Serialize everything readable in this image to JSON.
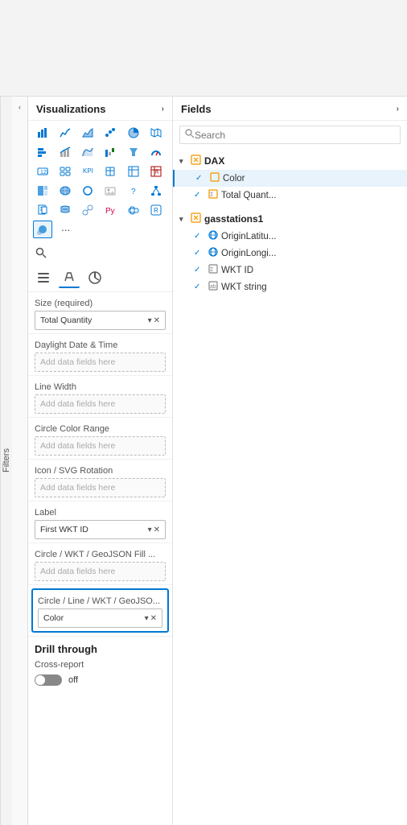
{
  "topBar": {
    "height": 120
  },
  "filters": {
    "label": "Filters"
  },
  "visualizations": {
    "title": "Visualizations",
    "arrow": "›"
  },
  "fields_panel": {
    "title": "Fields",
    "arrow": "›",
    "search_placeholder": "Search"
  },
  "search": {
    "label": "Search"
  },
  "fieldSections": [
    {
      "id": "size",
      "label": "Size (required)",
      "filled": true,
      "value": "Total Quantity",
      "placeholder": ""
    },
    {
      "id": "daylight",
      "label": "Daylight Date & Time",
      "filled": false,
      "value": "",
      "placeholder": "Add data fields here"
    },
    {
      "id": "linewidth",
      "label": "Line Width",
      "filled": false,
      "value": "",
      "placeholder": "Add data fields here"
    },
    {
      "id": "circlecolor",
      "label": "Circle Color Range",
      "filled": false,
      "value": "",
      "placeholder": "Add data fields here"
    },
    {
      "id": "iconsvg",
      "label": "Icon / SVG Rotation",
      "filled": false,
      "value": "",
      "placeholder": "Add data fields here"
    },
    {
      "id": "label",
      "label": "Label",
      "filled": true,
      "value": "First WKT ID",
      "placeholder": ""
    },
    {
      "id": "circlewkt",
      "label": "Circle / WKT / GeoJSON Fill ...",
      "filled": false,
      "value": "",
      "placeholder": "Add data fields here"
    }
  ],
  "highlightedSection": {
    "label": "Circle / Line / WKT / GeoJSO...",
    "value": "Color"
  },
  "drillThrough": {
    "title": "Drill through",
    "crossReport": "Cross-report",
    "toggleState": "off"
  },
  "daxGroup": {
    "name": "DAX",
    "items": [
      {
        "name": "Color",
        "icon": "table",
        "checked": true,
        "selected": true
      },
      {
        "name": "Total Quant...",
        "icon": "sigma",
        "checked": true,
        "selected": false
      }
    ]
  },
  "gasstationsGroup": {
    "name": "gasstations1",
    "items": [
      {
        "name": "OriginLatitu...",
        "icon": "globe",
        "checked": true
      },
      {
        "name": "OriginLongi...",
        "icon": "globe",
        "checked": true
      },
      {
        "name": "WKT ID",
        "icon": "sigma",
        "checked": true
      },
      {
        "name": "WKT string",
        "icon": "abc",
        "checked": true
      }
    ]
  },
  "icons": {
    "chevron_right": "›",
    "chevron_down": "▾",
    "chevron_up": "▴",
    "close": "✕",
    "search": "🔍",
    "check": "✓",
    "expand": "⌄"
  }
}
